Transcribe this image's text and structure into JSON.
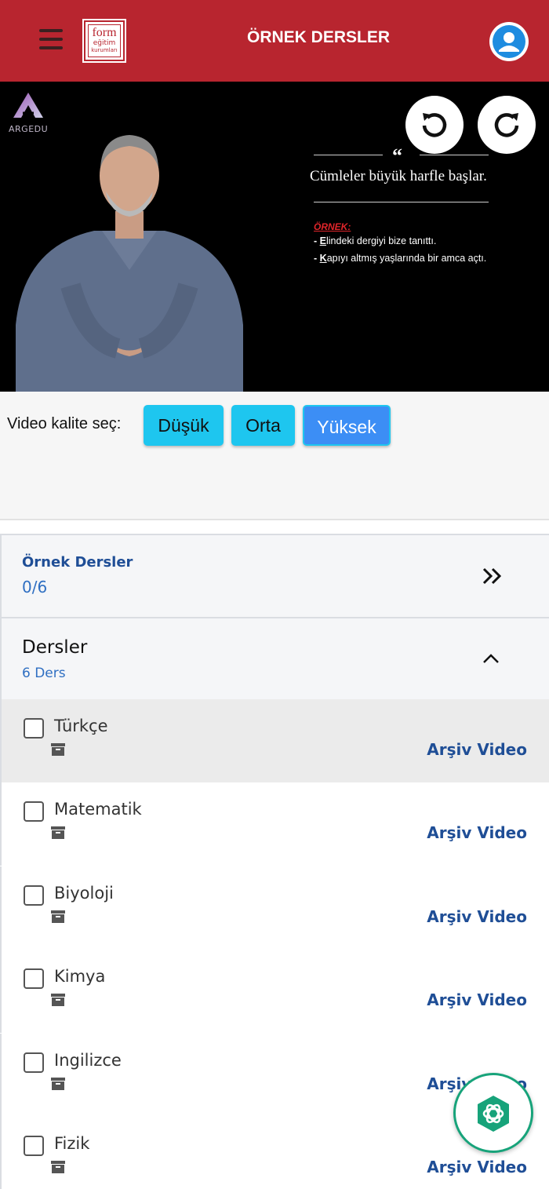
{
  "header": {
    "title": "ÖRNEK DERSLER",
    "logo": {
      "line1": "form",
      "line2": "eğitim",
      "line3": "kurumları"
    },
    "accent_color": "#b8252f"
  },
  "video": {
    "brand": "ARGEDU",
    "rewind_icon": "rotate-left-icon",
    "forward_icon": "rotate-right-icon",
    "slide": {
      "quote_mark": "“",
      "main_text": "Cümleler büyük harfle başlar.",
      "example_label": "ÖRNEK:",
      "examples": [
        {
          "dash": "-",
          "first": "E",
          "rest": "lindeki dergiyi bize tanıttı."
        },
        {
          "dash": "-",
          "first": "K",
          "rest": "apıyı altmış yaşlarında bir amca açtı."
        }
      ]
    }
  },
  "quality": {
    "label": "Video kalite seç:",
    "options": [
      {
        "label": "Düşük",
        "color": "#1ec6ef"
      },
      {
        "label": "Orta",
        "color": "#1ec6ef"
      },
      {
        "label": "Yüksek",
        "color": "#3c8ef5",
        "selected": true
      }
    ]
  },
  "sections": {
    "ornek": {
      "title": "Örnek Dersler",
      "progress": "0/6",
      "icon": "chevron-double-right-icon"
    },
    "dersler": {
      "title": "Dersler",
      "count": "6 Ders",
      "icon": "chevron-up-icon"
    }
  },
  "lessons": [
    {
      "name": "Türkçe",
      "link": "Arşiv Video",
      "highlighted": true
    },
    {
      "name": "Matematik",
      "link": "Arşiv Video"
    },
    {
      "name": "Biyoloji",
      "link": "Arşiv Video"
    },
    {
      "name": "Kimya",
      "link": "Arşiv Video"
    },
    {
      "name": "Ingilizce",
      "link": "Arşiv Video"
    },
    {
      "name": "Fizik",
      "link": "Arşiv Video"
    }
  ],
  "fab": {
    "icon": "openai-chat-icon",
    "color": "#17a37a"
  }
}
